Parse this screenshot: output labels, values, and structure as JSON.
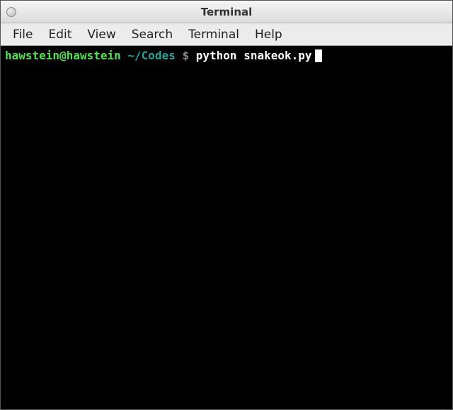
{
  "window": {
    "title": "Terminal"
  },
  "menubar": {
    "items": [
      "File",
      "Edit",
      "View",
      "Search",
      "Terminal",
      "Help"
    ]
  },
  "terminal": {
    "user_host": "hawstein@hawstein",
    "path": "~/Codes",
    "prompt_symbol": "$",
    "command": "python snakeok.py"
  }
}
